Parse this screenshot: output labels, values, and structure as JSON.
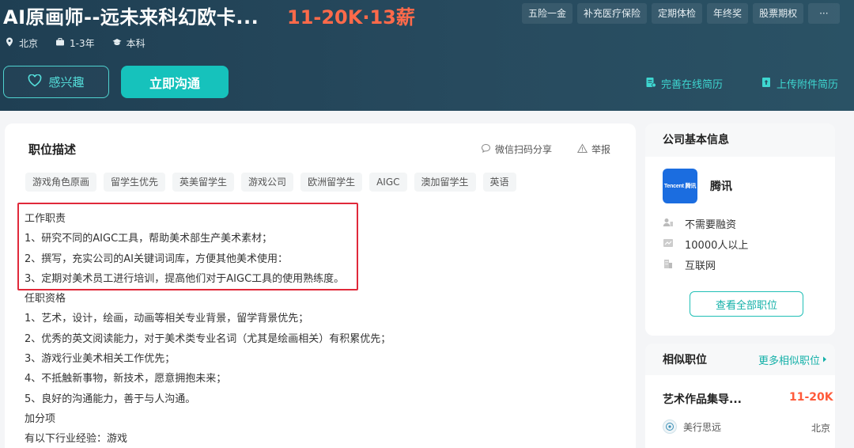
{
  "header": {
    "title": "AI原画师--远未来科幻欧卡...",
    "salary": "11-20K·13薪",
    "welfare": [
      "五险一金",
      "补充医疗保险",
      "定期体检",
      "年终奖",
      "股票期权",
      "···"
    ],
    "meta": {
      "city": "北京",
      "experience": "1-3年",
      "education": "本科"
    },
    "fav_label": "感兴趣",
    "chat_label": "立即沟通",
    "online_resume_label": "完善在线简历",
    "upload_resume_label": "上传附件简历"
  },
  "job": {
    "section_title": "职位描述",
    "share_label": "微信扫码分享",
    "report_label": "举报",
    "tags": [
      "游戏角色原画",
      "留学生优先",
      "英美留学生",
      "游戏公司",
      "欧洲留学生",
      "AIGC",
      "澳加留学生",
      "英语"
    ],
    "lines": [
      "工作职责",
      "1、研究不同的AIGC工具，帮助美术部生产美术素材；",
      "2、撰写，充实公司的AI关键词词库，方便其他美术使用：",
      "3、定期对美术员工进行培训，提高他们对于AIGC工具的使用熟练度。",
      "任职资格",
      "1、艺术，设计，绘画，动画等相关专业背景，留学背景优先；",
      "2、优秀的英文阅读能力，对于美术类专业名词（尤其是绘画相关）有积累优先；",
      "3、游戏行业美术相关工作优先；",
      "4、不抵触新事物，新技术，愿意拥抱未来；",
      "5、良好的沟通能力，善于与人沟通。",
      "加分项",
      "有以下行业经验：游戏"
    ]
  },
  "company": {
    "section_title": "公司基本信息",
    "logo_text": "Tencent 腾讯",
    "name": "腾讯",
    "funding": "不需要融资",
    "size": "10000人以上",
    "industry": "互联网",
    "all_jobs_label": "查看全部职位"
  },
  "similar": {
    "section_title": "相似职位",
    "more_label": "更多相似职位",
    "job_title": "艺术作品集导...",
    "job_salary": "11-20K",
    "company": "美行思远",
    "city": "北京"
  },
  "colors": {
    "header_bg": "#1f3f53",
    "accent": "#16c2bc",
    "salary": "#ff6a4a",
    "highlight": "#e0293a"
  }
}
